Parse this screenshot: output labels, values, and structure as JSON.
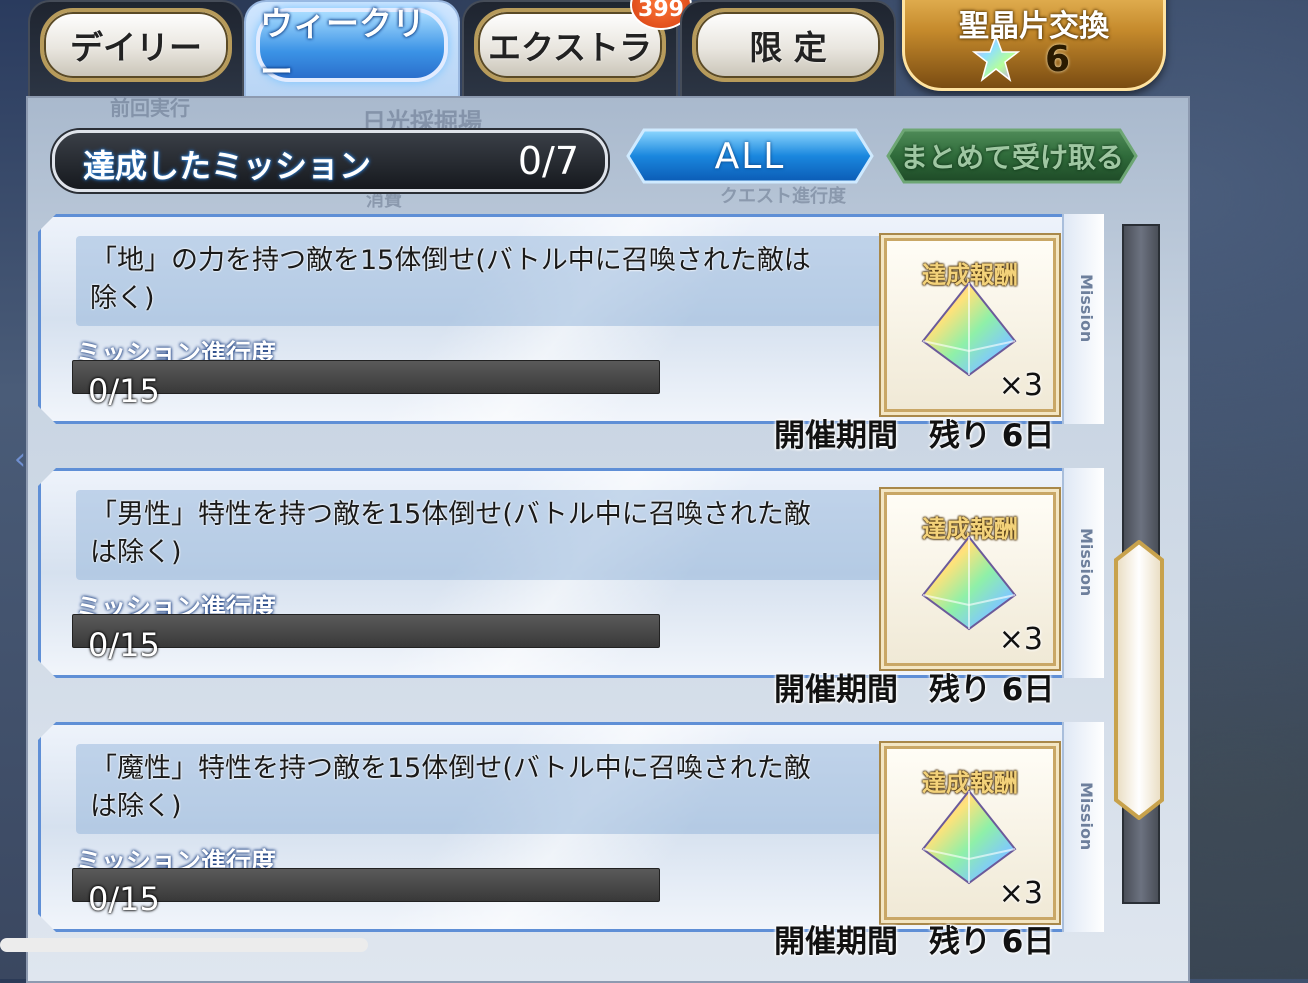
{
  "tabs": [
    {
      "label": "デイリー",
      "active": false
    },
    {
      "label": "ウィークリー",
      "active": true
    },
    {
      "label": "エクストラ",
      "active": false
    },
    {
      "label": "限 定",
      "active": false
    }
  ],
  "badge": "399",
  "exchange": {
    "label": "聖晶片交換",
    "count": "6",
    "icon": "saint-quartz-fragment-icon"
  },
  "summary": {
    "label": "達成したミッション",
    "count": "0/7"
  },
  "filter_label": "ALL",
  "receive_all_label": "まとめて受け取る",
  "background_text": [
    "前回実行",
    "日光採掘場",
    "消費",
    "クエスト進行度"
  ],
  "missions": [
    {
      "description": "「地」の力を持つ敵を15体倒せ(バトル中に召喚された敵は除く)",
      "progress_label": "ミッション進行度",
      "progress_text": "0/15",
      "progress_value": 0,
      "reward_label": "達成報酬",
      "reward_qty": "×3",
      "reward_icon": "saint-quartz-icon",
      "side_tag": "Mission",
      "period": "開催期間　残り 6日"
    },
    {
      "description": "「男性」特性を持つ敵を15体倒せ(バトル中に召喚された敵は除く)",
      "progress_label": "ミッション進行度",
      "progress_text": "0/15",
      "progress_value": 0,
      "reward_label": "達成報酬",
      "reward_qty": "×3",
      "reward_icon": "saint-quartz-icon",
      "side_tag": "Mission",
      "period": "開催期間　残り 6日"
    },
    {
      "description": "「魔性」特性を持つ敵を15体倒せ(バトル中に召喚された敵は除く)",
      "progress_label": "ミッション進行度",
      "progress_text": "0/15",
      "progress_value": 0,
      "reward_label": "達成報酬",
      "reward_qty": "×3",
      "reward_icon": "saint-quartz-icon",
      "side_tag": "Mission",
      "period": "開催期間　残り 6日"
    }
  ],
  "colors": {
    "accent_blue": "#3b93e6",
    "gold": "#c9a766",
    "receive_green": "#2f6b3a"
  }
}
